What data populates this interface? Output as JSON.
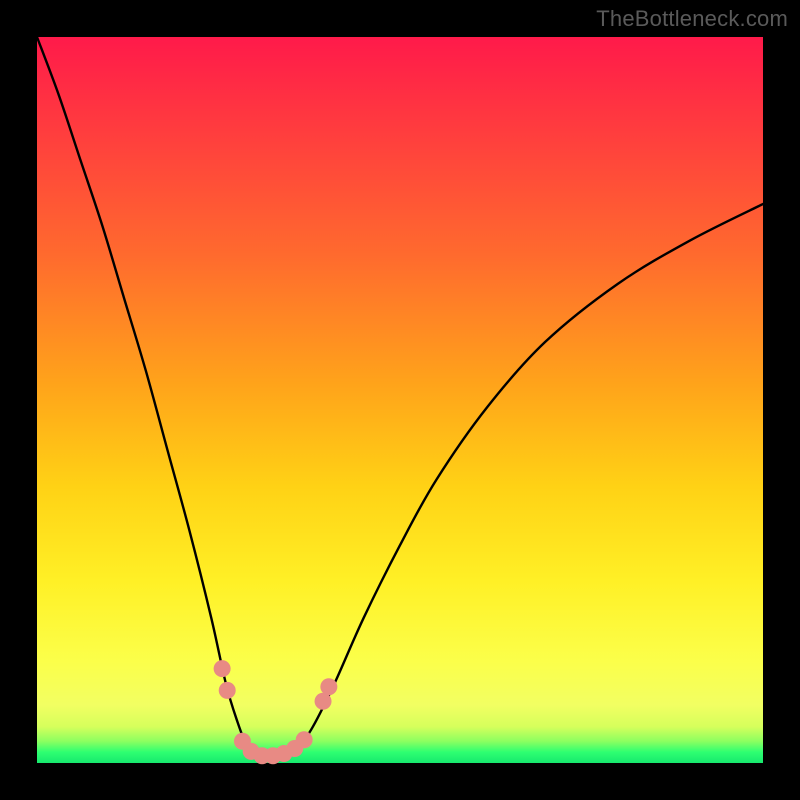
{
  "watermark": "TheBottleneck.com",
  "chart_data": {
    "type": "line",
    "title": "",
    "xlabel": "",
    "ylabel": "",
    "xlim": [
      0,
      100
    ],
    "ylim": [
      0,
      100
    ],
    "series": [
      {
        "name": "bottleneck-curve",
        "x": [
          0,
          3,
          6,
          9,
          12,
          15,
          18,
          21,
          24,
          26,
          27.5,
          29,
          30.5,
          32,
          34,
          36,
          38,
          41,
          45,
          50,
          55,
          62,
          70,
          80,
          90,
          100
        ],
        "y": [
          100,
          92,
          83,
          74,
          64,
          54,
          43,
          32,
          20,
          11,
          6,
          2.2,
          1.2,
          1,
          1.2,
          2.2,
          5,
          11,
          20,
          30,
          39,
          49,
          58,
          66,
          72,
          77
        ]
      }
    ],
    "markers": {
      "name": "highlight-dots",
      "color": "#e88a84",
      "points": [
        {
          "x": 25.5,
          "y": 13
        },
        {
          "x": 26.2,
          "y": 10
        },
        {
          "x": 28.3,
          "y": 3.0
        },
        {
          "x": 29.5,
          "y": 1.6
        },
        {
          "x": 31.0,
          "y": 1.0
        },
        {
          "x": 32.5,
          "y": 1.0
        },
        {
          "x": 34.0,
          "y": 1.3
        },
        {
          "x": 35.5,
          "y": 2.0
        },
        {
          "x": 36.8,
          "y": 3.2
        },
        {
          "x": 39.4,
          "y": 8.5
        },
        {
          "x": 40.2,
          "y": 10.5
        }
      ]
    },
    "gradient_stops": [
      {
        "pos": 0.0,
        "color": "#ff1a4a"
      },
      {
        "pos": 0.12,
        "color": "#ff3a3f"
      },
      {
        "pos": 0.3,
        "color": "#ff6a2e"
      },
      {
        "pos": 0.48,
        "color": "#ffa41a"
      },
      {
        "pos": 0.62,
        "color": "#ffd215"
      },
      {
        "pos": 0.75,
        "color": "#fff026"
      },
      {
        "pos": 0.86,
        "color": "#fbff4a"
      },
      {
        "pos": 0.92,
        "color": "#f2ff62"
      },
      {
        "pos": 0.95,
        "color": "#d6ff5c"
      },
      {
        "pos": 0.97,
        "color": "#8cff60"
      },
      {
        "pos": 0.985,
        "color": "#2eff71"
      },
      {
        "pos": 1.0,
        "color": "#17e96e"
      }
    ]
  }
}
